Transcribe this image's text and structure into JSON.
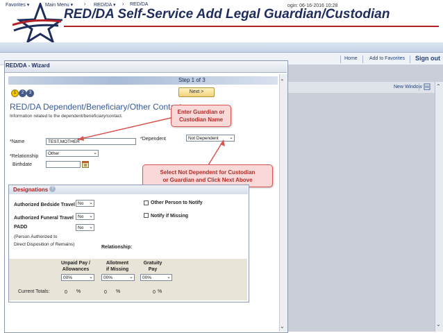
{
  "slide": {
    "title": "RED/DA Self-Service Add Legal Guardian/Custodian"
  },
  "menubar": {
    "items": [
      "Favorites ▾",
      "Main Menu ▾",
      "›",
      "RED/DA ▾",
      "›",
      "RED/DA"
    ]
  },
  "topstrip": {
    "login_text": "ogin: 06-16-2016 10:28",
    "home": "Home",
    "add_favorites": "Add to Favorites",
    "sign_out": "Sign out",
    "new_window": "New Window"
  },
  "wizard": {
    "title": "RED/DA - Wizard",
    "step_label": "Step 1 of 3",
    "steps": [
      "1",
      "2",
      "3"
    ],
    "next_label": "Next >",
    "heading": "RED/DA Dependent/Beneficiary/Other Contact",
    "subtitle": "Information related to the dependent/beneficiary/contact."
  },
  "form": {
    "name_label": "*Name",
    "name_value": "TEST,MOTHER",
    "dependent_label": "*Dependent",
    "dependent_value": "Not Dependent",
    "relationship_label": "*Relationship",
    "relationship_value": "Other",
    "birthdate_label": "Birthdate",
    "birthdate_value": ""
  },
  "callouts": {
    "name_line1": "Enter Guardian or",
    "name_line2": "Custodian Name",
    "dependent_line1": "Select Not Dependent for Custodian",
    "dependent_line2": "or Guardian and Click Next Above"
  },
  "designations": {
    "title": "Designations",
    "help": "?",
    "bedside_label": "Authorized Bedside Travel",
    "bedside_value": "No",
    "funeral_label": "Authorized Funeral Travel",
    "funeral_value": "No",
    "padd_label": "PADD",
    "padd_value": "No",
    "padd_note1": "(Person Authorized to",
    "padd_note2": "Direct Disposition of Remains)",
    "relationship_label": "Relationship:",
    "other_person_label": "Other Person to Notify",
    "notify_missing_label": "Notify if Missing",
    "unpaid_line1": "Unpaid Pay /",
    "unpaid_line2": "Allowances",
    "allotment_line1": "Allotment",
    "allotment_line2": "if Missing",
    "gratuity_line1": "Gratuity",
    "gratuity_line2": "Pay",
    "unpaid_value": "00%",
    "allotment_value": "00%",
    "gratuity_value": "00%",
    "totals_label": "Current Totals:",
    "total_unpaid": "0",
    "total_allotment": "0",
    "total_gratuity": "0",
    "percent": "%"
  },
  "colors": {
    "title_blue": "#1f2d5c",
    "title_rule": "#b32026",
    "callout_border": "#d9534f",
    "callout_text": "#b52a26",
    "heading_blue": "#355a9a"
  }
}
